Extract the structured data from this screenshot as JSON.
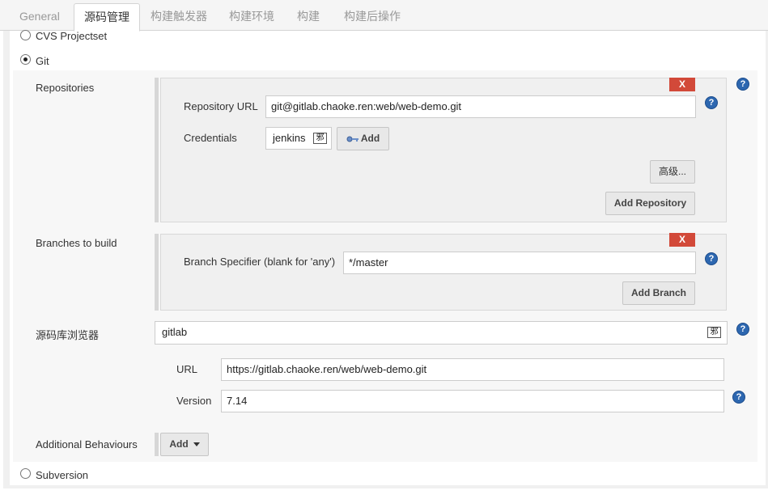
{
  "tabs": [
    "General",
    "源码管理",
    "构建触发器",
    "构建环境",
    "构建",
    "构建后操作"
  ],
  "scm_options": {
    "cvs_projectset": "CVS Projectset",
    "git": "Git",
    "subversion": "Subversion"
  },
  "repositories": {
    "label": "Repositories",
    "delete_label": "X",
    "url_label": "Repository URL",
    "url_value": "git@gitlab.chaoke.ren:web/web-demo.git",
    "credentials_label": "Credentials",
    "credentials_value": "jenkins",
    "credentials_add_label": "Add",
    "advanced_label": "高级...",
    "add_repository_label": "Add Repository"
  },
  "branches": {
    "label": "Branches to build",
    "delete_label": "X",
    "specifier_label": "Branch Specifier (blank for 'any')",
    "specifier_value": "*/master",
    "add_branch_label": "Add Branch"
  },
  "browser": {
    "label": "源码库浏览器",
    "value": "gitlab",
    "url_label": "URL",
    "url_value": "https://gitlab.chaoke.ren/web/web-demo.git",
    "version_label": "Version",
    "version_value": "7.14"
  },
  "additional": {
    "label": "Additional Behaviours",
    "add_label": "Add"
  },
  "help_glyph": "?",
  "select_glyph": "邪"
}
